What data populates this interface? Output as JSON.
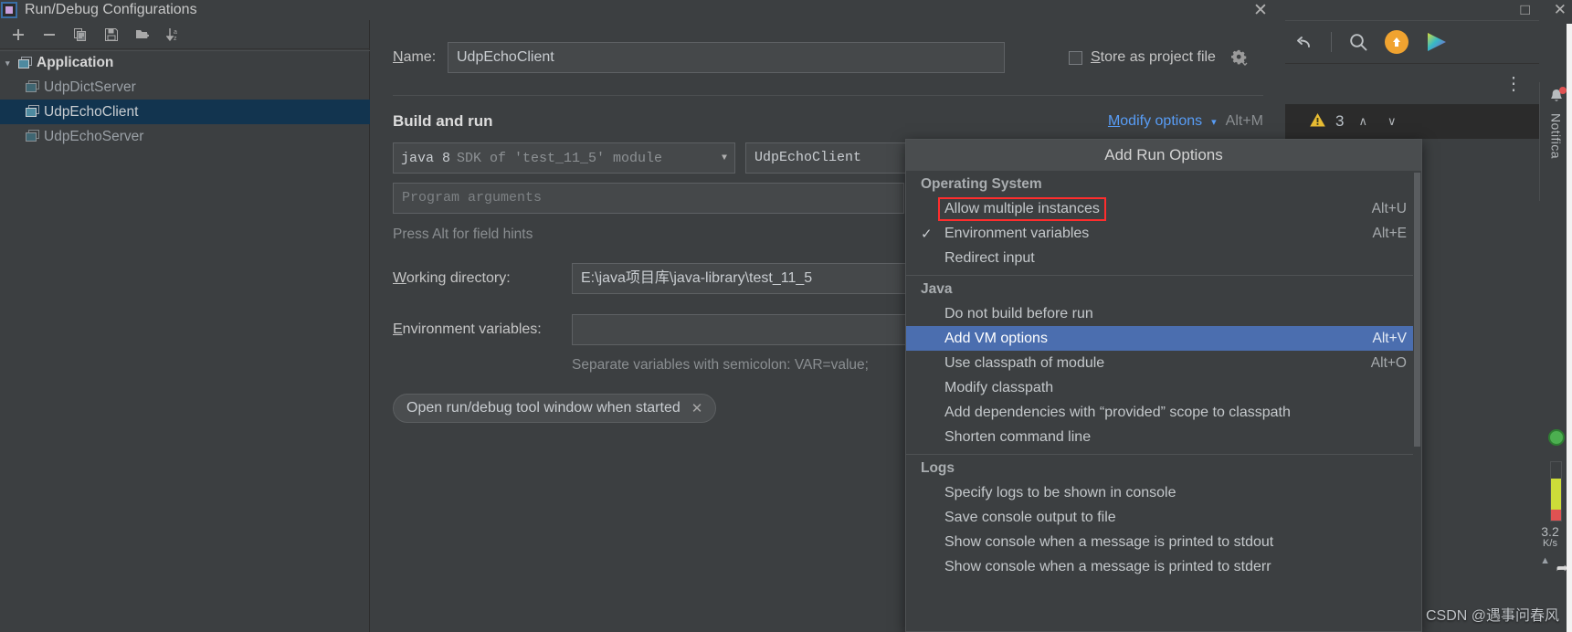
{
  "dialog": {
    "title": "Run/Debug Configurations",
    "close_label": "✕",
    "app_icon": "intellij-app-icon"
  },
  "tree_toolbar": {
    "items": [
      {
        "name": "add-configuration-button",
        "icon": "plus-icon",
        "label": "+"
      },
      {
        "name": "remove-configuration-button",
        "icon": "minus-icon",
        "label": "−"
      },
      {
        "name": "copy-configuration-button",
        "icon": "copy-icon",
        "label": ""
      },
      {
        "name": "save-configuration-button",
        "icon": "save-icon",
        "label": ""
      },
      {
        "name": "new-folder-button",
        "icon": "folder-add-icon",
        "label": ""
      },
      {
        "name": "sort-configurations-button",
        "icon": "sort-az-icon",
        "label": ""
      }
    ]
  },
  "tree": {
    "group_label": "Application",
    "items": [
      {
        "label": "UdpDictServer",
        "selected": false
      },
      {
        "label": "UdpEchoClient",
        "selected": true
      },
      {
        "label": "UdpEchoServer",
        "selected": false
      }
    ]
  },
  "form": {
    "name_label": "Name:",
    "name_label_mnemonic": "N",
    "name_value": "UdpEchoClient",
    "store_as_project_file_label": "Store as project file",
    "store_as_project_file_mnemonic": "S",
    "store_as_project_file_checked": false,
    "gear_icon": "gear-dropdown-icon",
    "build_and_run_title": "Build and run",
    "modify_options_label": "Modify options",
    "modify_options_mnemonic": "M",
    "modify_options_shortcut": "Alt+M",
    "sdk_value_prefix": "java 8",
    "sdk_value_suffix": "SDK of 'test_11_5' module",
    "main_class_value": "UdpEchoClient",
    "program_arguments_placeholder": "Program arguments",
    "field_hint": "Press Alt for field hints",
    "working_directory_label": "Working directory:",
    "working_directory_mnemonic": "W",
    "working_directory_value": "E:\\java项目库\\java-library\\test_11_5",
    "environment_variables_label": "Environment variables:",
    "environment_variables_mnemonic": "E",
    "environment_variables_value": "",
    "environment_variables_hint": "Separate variables with semicolon: VAR=value;",
    "chip_label": "Open run/debug tool window when started",
    "chip_close": "✕"
  },
  "popup": {
    "header": "Add Run Options",
    "sections": [
      {
        "title": "Operating System",
        "items": [
          {
            "label": "Allow multiple instances",
            "shortcut": "Alt+U",
            "checked": false,
            "highlight": false,
            "boxed": true
          },
          {
            "label": "Environment variables",
            "shortcut": "Alt+E",
            "checked": true,
            "highlight": false,
            "boxed": false
          },
          {
            "label": "Redirect input",
            "shortcut": "",
            "checked": false,
            "highlight": false,
            "boxed": false
          }
        ]
      },
      {
        "title": "Java",
        "items": [
          {
            "label": "Do not build before run",
            "shortcut": "",
            "checked": false,
            "highlight": false,
            "boxed": false
          },
          {
            "label": "Add VM options",
            "shortcut": "Alt+V",
            "checked": false,
            "highlight": true,
            "boxed": false
          },
          {
            "label": "Use classpath of module",
            "shortcut": "Alt+O",
            "checked": false,
            "highlight": false,
            "boxed": false
          },
          {
            "label": "Modify classpath",
            "shortcut": "",
            "checked": false,
            "highlight": false,
            "boxed": false
          },
          {
            "label": "Add dependencies with “provided” scope to classpath",
            "shortcut": "",
            "checked": false,
            "highlight": false,
            "boxed": false
          },
          {
            "label": "Shorten command line",
            "shortcut": "",
            "checked": false,
            "highlight": false,
            "boxed": false
          }
        ]
      },
      {
        "title": "Logs",
        "items": [
          {
            "label": "Specify logs to be shown in console",
            "shortcut": "",
            "checked": false,
            "highlight": false,
            "boxed": false
          },
          {
            "label": "Save console output to file",
            "shortcut": "",
            "checked": false,
            "highlight": false,
            "boxed": false
          },
          {
            "label": "Show console when a message is printed to stdout",
            "shortcut": "",
            "checked": false,
            "highlight": false,
            "boxed": false
          },
          {
            "label": "Show console when a message is printed to stderr",
            "shortcut": "",
            "checked": false,
            "highlight": false,
            "boxed": false
          }
        ]
      }
    ]
  },
  "ide": {
    "window_controls": [
      {
        "name": "maximize-window-button",
        "label": "□"
      },
      {
        "name": "close-window-button",
        "label": "✕"
      }
    ],
    "toolbar": [
      {
        "name": "undo-button",
        "icon": "undo-icon"
      },
      {
        "name": "search-everywhere-button",
        "icon": "search-icon"
      },
      {
        "name": "update-project-button",
        "icon": "arrow-up-circle-icon"
      },
      {
        "name": "run-button",
        "icon": "play-triangle-icon"
      }
    ],
    "kebab_label": "⋮",
    "warning_count": "3",
    "warning_icon": "warning-triangle-icon",
    "nav_up": "∧",
    "nav_down": "∨",
    "notifications_label": "Notifica",
    "bell_icon": "bell-icon",
    "memory_rate": "3.2",
    "memory_unit": "K/s"
  },
  "watermark": "CSDN @遇事问春风"
}
